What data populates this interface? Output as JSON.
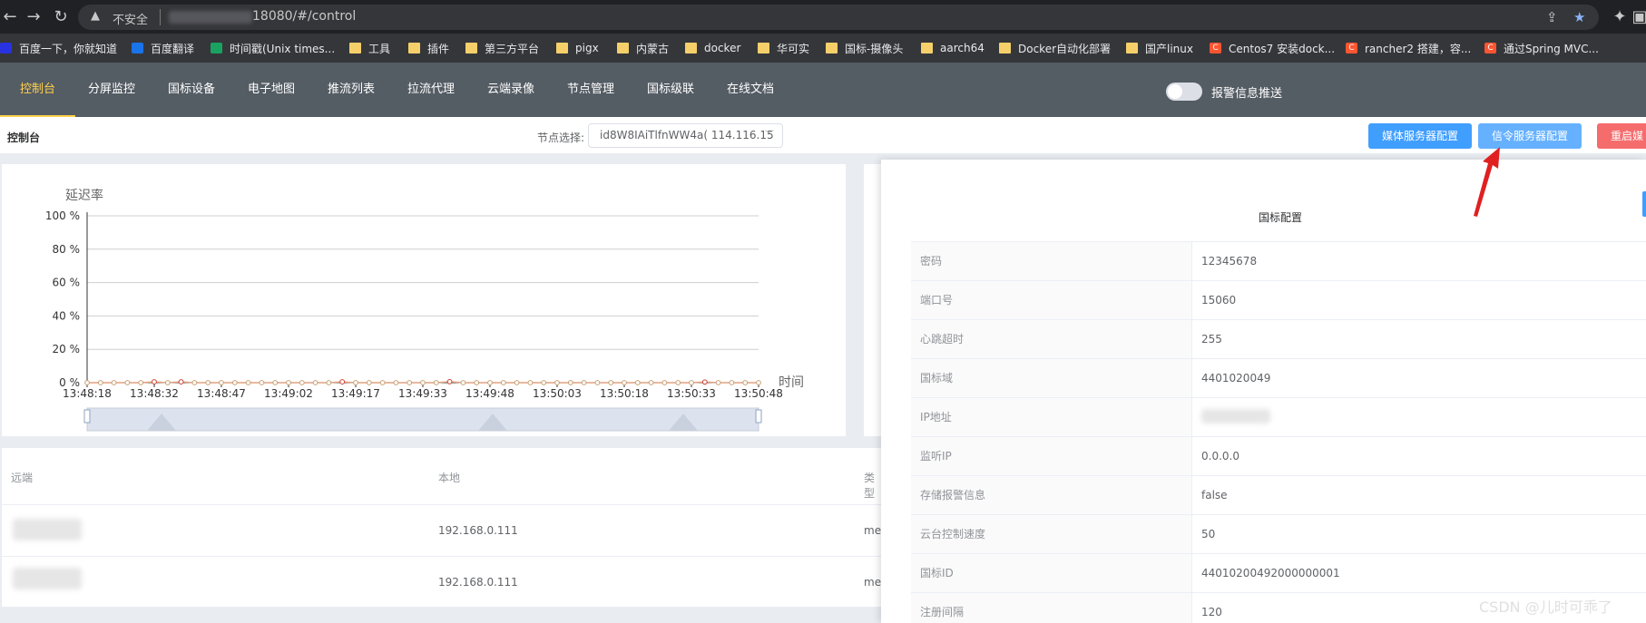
{
  "browser": {
    "insecure_label": "不安全",
    "url": "18080/#/control",
    "bookmarks": [
      {
        "label": "百度一下，你就知道",
        "icon": "baidu-icon"
      },
      {
        "label": "百度翻译",
        "icon": "translate-icon"
      },
      {
        "label": "时间戳(Unix times...",
        "icon": "tool-icon"
      },
      {
        "label": "工具",
        "icon": "folder-icon"
      },
      {
        "label": "插件",
        "icon": "folder-icon"
      },
      {
        "label": "第三方平台",
        "icon": "folder-icon"
      },
      {
        "label": "pigx",
        "icon": "folder-icon"
      },
      {
        "label": "内蒙古",
        "icon": "folder-icon"
      },
      {
        "label": "docker",
        "icon": "folder-icon"
      },
      {
        "label": "华可实",
        "icon": "folder-icon"
      },
      {
        "label": "国标-摄像头",
        "icon": "folder-icon"
      },
      {
        "label": "aarch64",
        "icon": "folder-icon"
      },
      {
        "label": "Docker自动化部署",
        "icon": "folder-icon"
      },
      {
        "label": "国产linux",
        "icon": "folder-icon"
      },
      {
        "label": "Centos7 安装dock...",
        "icon": "csdn-icon"
      },
      {
        "label": "rancher2 搭建，容...",
        "icon": "csdn-icon"
      },
      {
        "label": "通过Spring MVC...",
        "icon": "csdn-icon"
      }
    ]
  },
  "menu": {
    "items": [
      "控制台",
      "分屏监控",
      "国标设备",
      "电子地图",
      "推流列表",
      "拉流代理",
      "云端录像",
      "节点管理",
      "国标级联",
      "在线文档"
    ],
    "active_index": 0,
    "alarm_push_label": "报警信息推送"
  },
  "toolbar": {
    "page_title": "控制台",
    "node_label": "节点选择:",
    "node_value": "id8W8IAiTlfnWW4a( 114.116.15",
    "media_config_button": "媒体服务器配置",
    "signal_config_button": "信令服务器配置",
    "restart_button": "重启媒"
  },
  "chart_data": {
    "type": "line",
    "ylabel": "延迟率",
    "xlabel": "时间",
    "ylim": [
      0,
      100
    ],
    "yticks": [
      "100 %",
      "80 %",
      "60 %",
      "40 %",
      "20 %",
      "0 %"
    ],
    "x_tick_labels": [
      "13:48:18",
      "13:48:32",
      "13:48:47",
      "13:49:02",
      "13:49:17",
      "13:49:33",
      "13:49:48",
      "13:50:03",
      "13:50:18",
      "13:50:33",
      "13:50:48"
    ],
    "series": [
      {
        "values": [
          0,
          0,
          0,
          0,
          0,
          0.5,
          0,
          0.5,
          0,
          0,
          0,
          0,
          0,
          0,
          0,
          0,
          0,
          0,
          0,
          0.5,
          0,
          0,
          0,
          0,
          0,
          0,
          0,
          0.6,
          0,
          0,
          0,
          0,
          0,
          0,
          0,
          0,
          0,
          0,
          0,
          0,
          0,
          0,
          0,
          0,
          0,
          0,
          0.4,
          0,
          0,
          0,
          0
        ]
      }
    ],
    "colors": {
      "line": "#e0a080",
      "marker": "#c8a070",
      "highlight": "#d04030"
    }
  },
  "table": {
    "headers": [
      "远端",
      "本地",
      "类型"
    ],
    "rows": [
      {
        "remote": "",
        "local": "192.168.0.111",
        "type": "me"
      },
      {
        "remote": "",
        "local": "192.168.0.111",
        "type": "me"
      }
    ]
  },
  "config": {
    "title": "国标配置",
    "rows": [
      {
        "label": "密码",
        "value": "12345678"
      },
      {
        "label": "端口号",
        "value": "15060"
      },
      {
        "label": "心跳超时",
        "value": "255"
      },
      {
        "label": "国标域",
        "value": "4401020049"
      },
      {
        "label": "IP地址",
        "value": ""
      },
      {
        "label": "监听IP",
        "value": "0.0.0.0"
      },
      {
        "label": "存储报警信息",
        "value": "false"
      },
      {
        "label": "云台控制速度",
        "value": "50"
      },
      {
        "label": "国标ID",
        "value": "44010200492000000001"
      },
      {
        "label": "注册间隔",
        "value": "120"
      }
    ]
  },
  "watermark": "CSDN @儿时可乖了"
}
